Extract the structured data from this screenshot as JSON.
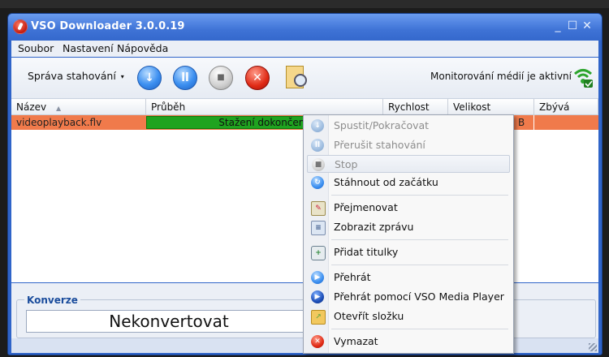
{
  "window": {
    "title": "VSO Downloader 3.0.0.19",
    "controls": [
      "_",
      "☐",
      "✕"
    ]
  },
  "menu": [
    "Soubor",
    "Nastavení",
    "Nápověda"
  ],
  "toolbar": {
    "label": "Správa stahování",
    "caret": "▾",
    "buttons": [
      "download-icon",
      "pause-icon",
      "stop-icon",
      "cancel-icon",
      "properties-icon"
    ],
    "monitor_text": "Monitorování médií je aktivní"
  },
  "table": {
    "headers": [
      "Název",
      "Průběh",
      "Rychlost",
      "Velikost",
      "Zbývá"
    ],
    "sort_arrow": "▲",
    "rows": [
      {
        "name": "videoplayback.flv",
        "progress_text": "Stažení dokončeno",
        "size_fragment": "B"
      }
    ]
  },
  "conversion": {
    "group_label": "Konverze",
    "value": "Nekonvertovat"
  },
  "context_menu": [
    {
      "label": "Spustit/Pokračovat",
      "icon": "play-icon",
      "disabled": true
    },
    {
      "label": "Přerušit stahování",
      "icon": "pause-icon",
      "disabled": true
    },
    {
      "label": "Stop",
      "icon": "stop-icon",
      "disabled": true
    },
    {
      "label": "Stáhnout od začátku",
      "icon": "restart-icon",
      "disabled": false
    },
    {
      "label": "Přejmenovat",
      "icon": "rename-icon",
      "disabled": false
    },
    {
      "label": "Zobrazit zprávu",
      "icon": "message-icon",
      "disabled": false
    },
    {
      "label": "Přidat titulky",
      "icon": "subtitles-icon",
      "disabled": false
    },
    {
      "label": "Přehrát",
      "icon": "play-icon",
      "disabled": false
    },
    {
      "label": "Přehrát pomocí VSO Media Player",
      "icon": "media-player-icon",
      "disabled": false
    },
    {
      "label": "Otevřít složku",
      "icon": "folder-icon",
      "disabled": false
    },
    {
      "label": "Vymazat",
      "icon": "delete-icon",
      "disabled": false
    }
  ],
  "colors": {
    "title_bar": "#3f73d6",
    "row_selected": "#f07a4b",
    "progress_done": "#1fa31f",
    "conversion_label": "#1a4c9c"
  }
}
